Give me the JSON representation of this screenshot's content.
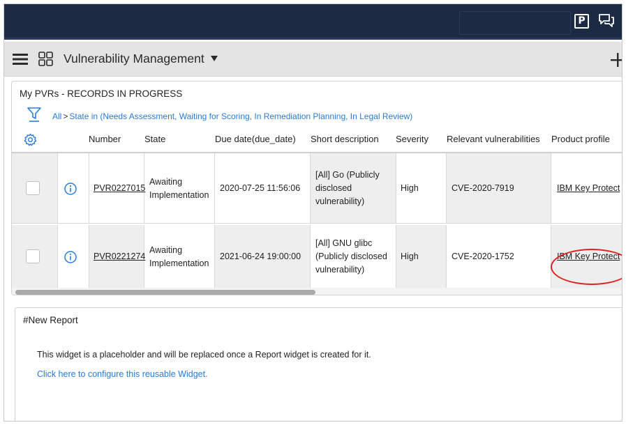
{
  "header": {
    "app_title": "Vulnerability Management",
    "profile_badge": "P"
  },
  "widget_records": {
    "title": "My PVRs - RECORDS IN PROGRESS",
    "breadcrumb": {
      "all_label": "All",
      "separator": ">",
      "filter_label": "State in (Needs Assessment, Waiting for Scoring, In Remediation Planning, In Legal Review)"
    },
    "columns": {
      "number": "Number",
      "state": "State",
      "due_date": "Due date(due_date)",
      "short_description": "Short description",
      "severity": "Severity",
      "relevant_vulnerabilities": "Relevant vulnerabilities",
      "product_profile": "Product profile"
    },
    "rows": [
      {
        "number": "PVR0227015",
        "state_line1": "Awaiting",
        "state_line2": "Implementation",
        "due_date": "2020-07-25 11:56:06",
        "desc_line1": "[All] Go (Publicly",
        "desc_line2": "disclosed",
        "desc_line3": "vulnerability)",
        "severity": "High",
        "vulnerabilities": "CVE-2020-7919",
        "product_profile": "IBM Key Protect"
      },
      {
        "number": "PVR0221274",
        "state_line1": "Awaiting",
        "state_line2": "Implementation",
        "due_date": "2021-06-24 19:00:00",
        "desc_line1": "[All] GNU glibc",
        "desc_line2": "(Publicly disclosed",
        "desc_line3": "vulnerability)",
        "severity": "High",
        "vulnerabilities": "CVE-2020-1752",
        "product_profile": "IBM Key Protect"
      }
    ]
  },
  "widget_report": {
    "title": "#New Report",
    "placeholder_text": "This widget is a placeholder and will be replaced once a Report widget is created for it.",
    "configure_link": "Click here to configure this reusable Widget."
  },
  "colors": {
    "topbar": "#1c2a44",
    "appbar": "#e4e4e4",
    "link": "#2a7bd4",
    "annotation": "#e02424"
  }
}
